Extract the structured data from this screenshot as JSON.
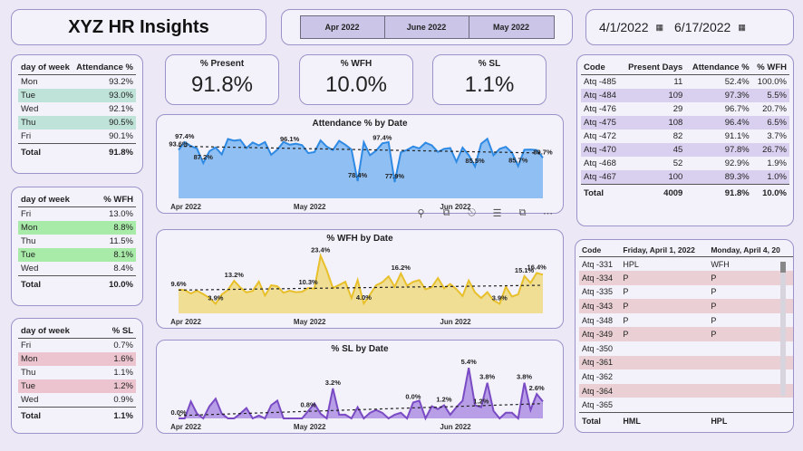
{
  "header": {
    "title": "XYZ HR Insights"
  },
  "tabs": [
    {
      "label": "Apr 2022"
    },
    {
      "label": "June 2022"
    },
    {
      "label": "May 2022"
    }
  ],
  "date_range": {
    "start": "4/1/2022",
    "end": "6/17/2022"
  },
  "kpis": [
    {
      "label": "% Present",
      "value": "91.8%"
    },
    {
      "label": "% WFH",
      "value": "10.0%"
    },
    {
      "label": "% SL",
      "value": "1.1%"
    }
  ],
  "attendance_table": {
    "headers": [
      "day of week",
      "Attendance %"
    ],
    "rows": [
      [
        "Mon",
        "93.2%"
      ],
      [
        "Tue",
        "93.0%"
      ],
      [
        "Wed",
        "92.1%"
      ],
      [
        "Thu",
        "90.5%"
      ],
      [
        "Fri",
        "90.1%"
      ]
    ],
    "highlight": [
      false,
      true,
      false,
      true,
      false
    ],
    "total": [
      "Total",
      "91.8%"
    ],
    "highlight_color": "#bfe3d8"
  },
  "wfh_table": {
    "headers": [
      "day of week",
      "% WFH"
    ],
    "rows": [
      [
        "Fri",
        "13.0%"
      ],
      [
        "Mon",
        "8.8%"
      ],
      [
        "Thu",
        "11.5%"
      ],
      [
        "Tue",
        "8.1%"
      ],
      [
        "Wed",
        "8.4%"
      ]
    ],
    "highlight": [
      false,
      true,
      false,
      true,
      false
    ],
    "total": [
      "Total",
      "10.0%"
    ],
    "highlight_color": "#a8eba8"
  },
  "sl_table": {
    "headers": [
      "day of week",
      "% SL"
    ],
    "rows": [
      [
        "Fri",
        "0.7%"
      ],
      [
        "Mon",
        "1.6%"
      ],
      [
        "Thu",
        "1.1%"
      ],
      [
        "Tue",
        "1.2%"
      ],
      [
        "Wed",
        "0.9%"
      ]
    ],
    "highlight": [
      false,
      true,
      false,
      true,
      false
    ],
    "total": [
      "Total",
      "1.1%"
    ],
    "highlight_color": "#ecc4cf"
  },
  "code_table": {
    "headers": [
      "Code",
      "Present Days",
      "Attendance %",
      "% WFH"
    ],
    "rows": [
      [
        "Atq -485",
        "11",
        "52.4%",
        "100.0%"
      ],
      [
        "Atq -484",
        "109",
        "97.3%",
        "5.5%"
      ],
      [
        "Atq -476",
        "29",
        "96.7%",
        "20.7%"
      ],
      [
        "Atq -475",
        "108",
        "96.4%",
        "6.5%"
      ],
      [
        "Atq -472",
        "82",
        "91.1%",
        "3.7%"
      ],
      [
        "Atq -470",
        "45",
        "97.8%",
        "26.7%"
      ],
      [
        "Atq -468",
        "52",
        "92.9%",
        "1.9%"
      ],
      [
        "Atq -467",
        "100",
        "89.3%",
        "1.0%"
      ]
    ],
    "total": [
      "Total",
      "4009",
      "91.8%",
      "10.0%"
    ],
    "stripe_color": "#d9d0ef"
  },
  "status_grid": {
    "headers": [
      "Code",
      "Friday, April 1, 2022",
      "Monday, April 4, 20"
    ],
    "rows": [
      [
        "Atq -331",
        "HPL",
        "WFH"
      ],
      [
        "Atq -334",
        "P",
        "P"
      ],
      [
        "Atq -335",
        "P",
        "P"
      ],
      [
        "Atq -343",
        "P",
        "P"
      ],
      [
        "Atq -348",
        "P",
        "P"
      ],
      [
        "Atq -349",
        "P",
        "P"
      ],
      [
        "Atq -350",
        "",
        ""
      ],
      [
        "Atq -361",
        "",
        ""
      ],
      [
        "Atq -362",
        "",
        ""
      ],
      [
        "Atq -364",
        "",
        ""
      ],
      [
        "Atq -365",
        "",
        ""
      ]
    ],
    "total": [
      "Total",
      "HML",
      "HPL"
    ],
    "stripe_color": "#ead0d4"
  },
  "visual_icons": [
    "pin-icon",
    "copy-icon",
    "bell-icon",
    "filter-icon",
    "expand-icon",
    "more-icon"
  ],
  "chart_data": [
    {
      "type": "area",
      "title": "Attendance % by Date",
      "x_ticks": [
        "Apr 2022",
        "May 2022",
        "Jun 2022"
      ],
      "ylim": [
        70,
        100
      ],
      "color": "#2f8ae4",
      "fill": "#8fbff3",
      "values": [
        93.6,
        97.4,
        95.5,
        94.2,
        87.2,
        93.0,
        94.8,
        91.4,
        98.9,
        98.1,
        98.5,
        94.5,
        97.2,
        95.8,
        97.4,
        91.2,
        93.7,
        97.5,
        96.1,
        96.6,
        95.9,
        92.0,
        92.5,
        98.2,
        95.2,
        93.5,
        98.0,
        96.1,
        93.8,
        78.4,
        97.3,
        91.0,
        93.2,
        96.8,
        97.4,
        77.9,
        92.4,
        93.6,
        95.3,
        94.3,
        97.1,
        95.8,
        92.6,
        94.1,
        94.5,
        87.8,
        94.7,
        91.1,
        85.5,
        96.6,
        99.0,
        91.0,
        94.1,
        95.1,
        92.3,
        85.7,
        93.7,
        93.8,
        93.5,
        89.7
      ],
      "labels": [
        [
          0,
          "93.6%"
        ],
        [
          1,
          "97.4%"
        ],
        [
          4,
          "87.2%"
        ],
        [
          18,
          "96.1%"
        ],
        [
          29,
          "78.4%"
        ],
        [
          35,
          "77.9%"
        ],
        [
          33,
          "97.4%"
        ],
        [
          48,
          "85.5%"
        ],
        [
          55,
          "85.7%"
        ],
        [
          59,
          "89.7%"
        ]
      ]
    },
    {
      "type": "area",
      "title": "% WFH by Date",
      "x_ticks": [
        "Apr 2022",
        "May 2022",
        "Jun 2022"
      ],
      "ylim": [
        0,
        25
      ],
      "color": "#e8c02b",
      "fill": "#f0de95",
      "values": [
        9.6,
        9.4,
        8.1,
        9.2,
        7.8,
        6.3,
        3.9,
        7.7,
        9.5,
        13.2,
        10.5,
        8.5,
        9.1,
        12.9,
        7.2,
        11.4,
        11.0,
        8.4,
        9.2,
        8.6,
        8.8,
        10.3,
        10.0,
        23.4,
        17.5,
        10.3,
        11.5,
        12.8,
        6.2,
        13.5,
        4.0,
        7.6,
        11.4,
        12.6,
        15.0,
        10.8,
        16.2,
        11.2,
        12.8,
        13.5,
        9.7,
        10.6,
        14.3,
        10.2,
        11.9,
        9.8,
        7.0,
        13.3,
        8.5,
        6.2,
        8.6,
        5.3,
        3.9,
        10.8,
        6.8,
        7.7,
        15.1,
        12.4,
        16.4,
        15.7
      ],
      "labels": [
        [
          0,
          "9.6%"
        ],
        [
          6,
          "3.9%"
        ],
        [
          9,
          "13.2%"
        ],
        [
          23,
          "23.4%"
        ],
        [
          21,
          "10.3%"
        ],
        [
          30,
          "4.0%"
        ],
        [
          36,
          "16.2%"
        ],
        [
          52,
          "3.9%"
        ],
        [
          56,
          "15.1%"
        ],
        [
          58,
          "16.4%"
        ]
      ]
    },
    {
      "type": "area",
      "title": "% SL by Date",
      "x_ticks": [
        "Apr 2022",
        "May 2022",
        "Jun 2022"
      ],
      "ylim": [
        0,
        6
      ],
      "color": "#7a4bc4",
      "fill": "#b79ee6",
      "values": [
        0.0,
        0.0,
        1.8,
        0.5,
        0.0,
        1.3,
        2.1,
        0.5,
        0.0,
        0.0,
        0.5,
        1.1,
        0.0,
        0.3,
        0.0,
        1.4,
        1.9,
        0.0,
        0.0,
        0.0,
        0.0,
        0.8,
        1.6,
        0.5,
        0.0,
        3.2,
        0.4,
        0.4,
        0.0,
        1.2,
        0.0,
        0.6,
        0.9,
        0.6,
        0.0,
        0.4,
        0.6,
        0.0,
        1.7,
        1.9,
        0.0,
        1.3,
        1.0,
        1.4,
        0.4,
        1.2,
        1.9,
        5.4,
        1.4,
        1.2,
        3.8,
        0.8,
        0.0,
        0.6,
        0.6,
        0.0,
        3.8,
        0.9,
        2.6,
        1.8
      ],
      "labels": [
        [
          0,
          "0.0%"
        ],
        [
          21,
          "0.8%"
        ],
        [
          25,
          "3.2%"
        ],
        [
          38,
          "0.0%"
        ],
        [
          43,
          "1.2%"
        ],
        [
          47,
          "5.4%"
        ],
        [
          49,
          "1.2%"
        ],
        [
          50,
          "3.8%"
        ],
        [
          56,
          "3.8%"
        ],
        [
          58,
          "2.6%"
        ]
      ]
    }
  ]
}
